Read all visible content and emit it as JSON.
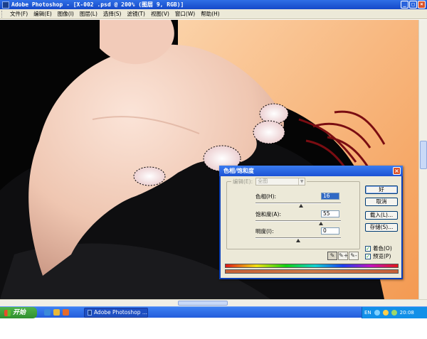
{
  "window": {
    "title": "Adobe Photoshop - [X-002 .psd @ 200% (图层 9, RGB)]",
    "minimize": "_",
    "maximize": "□",
    "close": "×"
  },
  "menu": {
    "items": [
      {
        "label": "文件(F)"
      },
      {
        "label": "编辑(E)"
      },
      {
        "label": "图像(I)"
      },
      {
        "label": "图层(L)"
      },
      {
        "label": "选择(S)"
      },
      {
        "label": "滤镜(T)"
      },
      {
        "label": "视图(V)"
      },
      {
        "label": "窗口(W)"
      },
      {
        "label": "帮助(H)"
      }
    ]
  },
  "dialog": {
    "title": "色相/饱和度",
    "close": "×",
    "edit_label": "编辑(E):",
    "edit_value": "全图",
    "sliders": [
      {
        "label": "色相(H):",
        "value": "16",
        "knob_fraction": 0.53,
        "active": true
      },
      {
        "label": "饱和度(A):",
        "value": "55",
        "knob_fraction": 0.77,
        "active": false
      },
      {
        "label": "明度(I):",
        "value": "0",
        "knob_fraction": 0.5,
        "active": false
      }
    ],
    "buttons": {
      "ok": "好",
      "cancel": "取消",
      "load": "载入(L)...",
      "save": "存储(S)..."
    },
    "colorize": {
      "label": "着色(O)",
      "checked": true
    },
    "preview": {
      "label": "预览(P)",
      "checked": true
    },
    "eyedroppers": [
      "✎",
      "✎+",
      "✎-"
    ]
  },
  "taskbar": {
    "start_label": "开始",
    "task_label": "Adobe Photoshop ...",
    "lang": "EN",
    "time": "20:08"
  },
  "colors": {
    "accent": "#1c52d4",
    "skin": "#f0c8b4",
    "orange": "#f8a060"
  }
}
